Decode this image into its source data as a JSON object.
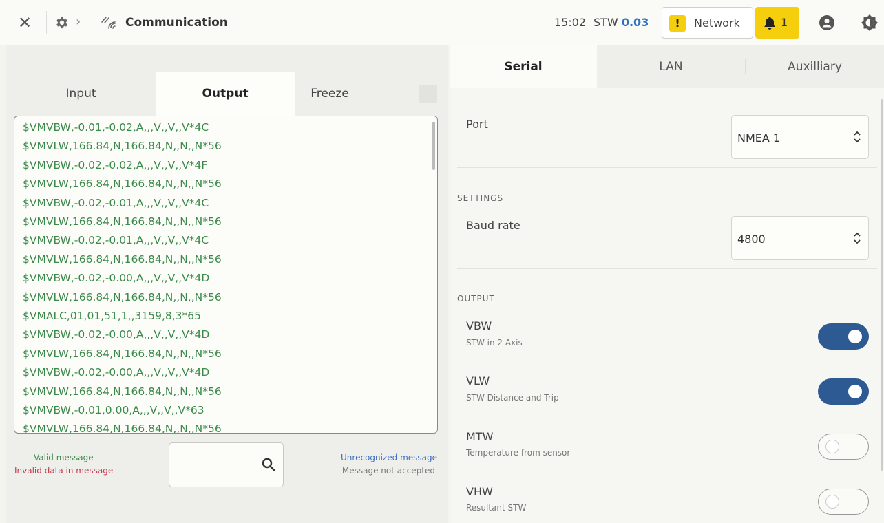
{
  "topbar": {
    "title": "Communication",
    "time": "15:02",
    "stw_label": "STW",
    "stw_value": "0.03",
    "network_label": "Network",
    "warn_symbol": "!",
    "alert_count": "1",
    "close_symbol": "✕",
    "chevron_symbol": "›"
  },
  "left": {
    "tabs": [
      "Input",
      "Output",
      "Freeze"
    ],
    "active_tab": "Output",
    "log_lines": [
      "$VMVBW,-0.01,-0.02,A,,,V,,V,,V*4C",
      "$VMVLW,166.84,N,166.84,N,,N,,N*56",
      "$VMVBW,-0.02,-0.02,A,,,V,,V,,V*4F",
      "$VMVLW,166.84,N,166.84,N,,N,,N*56",
      "$VMVBW,-0.02,-0.01,A,,,V,,V,,V*4C",
      "$VMVLW,166.84,N,166.84,N,,N,,N*56",
      "$VMVBW,-0.02,-0.01,A,,,V,,V,,V*4C",
      "$VMVLW,166.84,N,166.84,N,,N,,N*56",
      "$VMVBW,-0.02,-0.00,A,,,V,,V,,V*4D",
      "$VMVLW,166.84,N,166.84,N,,N,,N*56",
      "$VMALC,01,01,51,1,,3159,8,3*65",
      "$VMVBW,-0.02,-0.00,A,,,V,,V,,V*4D",
      "$VMVLW,166.84,N,166.84,N,,N,,N*56",
      "$VMVBW,-0.02,-0.00,A,,,V,,V,,V*4D",
      "$VMVLW,166.84,N,166.84,N,,N,,N*56",
      "$VMVBW,-0.01,0.00,A,,,V,,V,,V*63",
      "$VMVLW,166.84,N,166.84,N,,N,,N*56"
    ],
    "legend": {
      "valid": "Valid message",
      "invalid": "Invalid data in message",
      "unrecognized": "Unrecognized message",
      "not_accepted": "Message not accepted"
    },
    "search": {
      "value": "",
      "placeholder": ""
    }
  },
  "right": {
    "tabs": [
      "Serial",
      "LAN",
      "Auxilliary"
    ],
    "active_tab": "Serial",
    "port": {
      "label": "Port",
      "value": "NMEA 1"
    },
    "settings_header": "SETTINGS",
    "baud": {
      "label": "Baud rate",
      "value": "4800"
    },
    "output_header": "OUTPUT",
    "outputs": [
      {
        "name": "VBW",
        "desc": "STW in 2 Axis",
        "on": true
      },
      {
        "name": "VLW",
        "desc": "STW Distance and Trip",
        "on": true
      },
      {
        "name": "MTW",
        "desc": "Temperature from sensor",
        "on": false
      },
      {
        "name": "VHW",
        "desc": "Resultant STW",
        "on": false
      }
    ]
  },
  "colors": {
    "valid": "#3a8a4a",
    "invalid": "#c23a4a",
    "unrecognized": "#3a6ec2",
    "toggle_on": "#2e5a94",
    "warning": "#f5cf0d"
  }
}
